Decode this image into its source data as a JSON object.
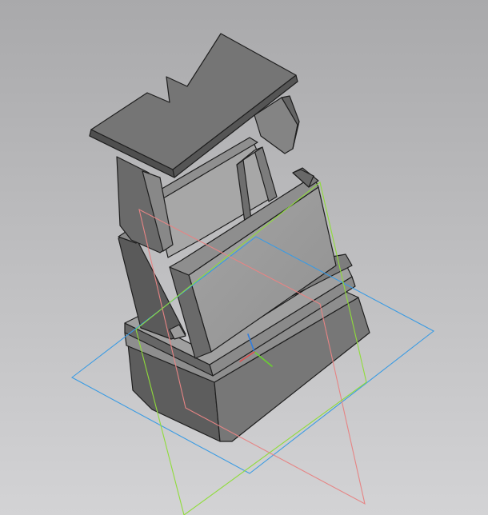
{
  "viewport": {
    "background_top": "#a9a9ab",
    "background_bottom": "#d3d3d5"
  },
  "planes": {
    "xy_color": "#3a9be3",
    "zx_color": "#e68484",
    "yz_color": "#8fdc3a"
  },
  "axes": {
    "x_color": "#e05050",
    "y_color": "#6ad030",
    "z_color": "#2f7de0"
  },
  "part": {
    "face_dark": "#5b5b5b",
    "face_mid": "#777777",
    "face_light": "#9a9a9a",
    "face_lighter": "#a9a9a9",
    "edge_color": "#1e1e1e"
  }
}
